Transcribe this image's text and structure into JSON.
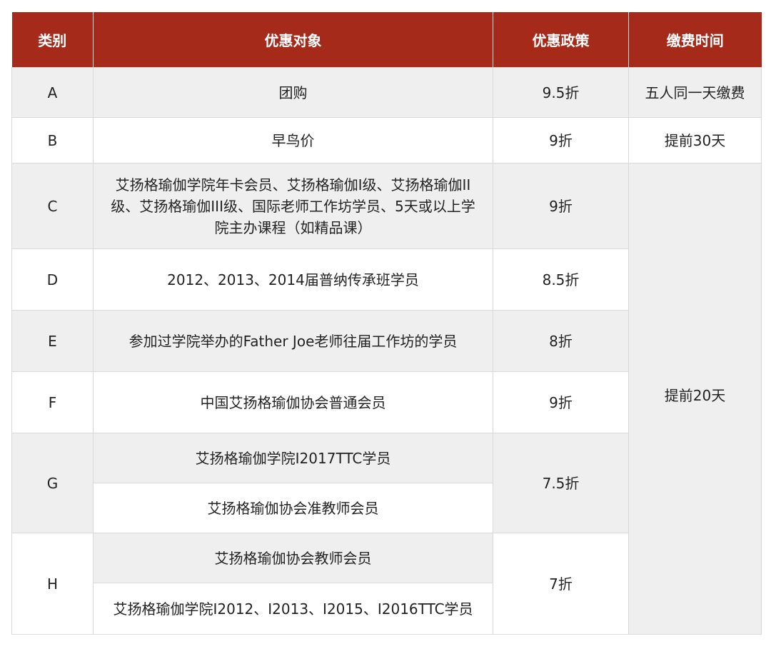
{
  "header": {
    "category": "类别",
    "target": "优惠对象",
    "policy": "优惠政策",
    "time": "缴费时间"
  },
  "rows": [
    {
      "category": "A",
      "target": "团购",
      "policy": "9.5折",
      "time": "五人同一天缴费"
    },
    {
      "category": "B",
      "target": "早鸟价",
      "policy": "9折",
      "time": "提前30天"
    },
    {
      "category": "C",
      "target": "艾扬格瑜伽学院年卡会员、艾扬格瑜伽I级、艾扬格瑜伽II级、艾扬格瑜伽III级、国际老师工作坊学员、5天或以上学院主办课程（如精品课）",
      "policy": "9折",
      "time": "提前20天"
    },
    {
      "category": "D",
      "target": "2012、2013、2014届普纳传承班学员",
      "policy": "8.5折"
    },
    {
      "category": "E",
      "target": "参加过学院举办的Father Joe老师往届工作坊的学员",
      "policy": "8折"
    },
    {
      "category": "F",
      "target": "中国艾扬格瑜伽协会普通会员",
      "policy": "9折"
    },
    {
      "category": "G",
      "targets": [
        "艾扬格瑜伽学院I2017TTC学员",
        "艾扬格瑜伽协会准教师会员"
      ],
      "policy": "7.5折"
    },
    {
      "category": "H",
      "targets": [
        "艾扬格瑜伽协会教师会员",
        "艾扬格瑜伽学院I2012、I2013、I2015、I2016TTC学员"
      ],
      "policy": "7折"
    }
  ],
  "colors": {
    "header_bg": "#a52a1a",
    "header_text": "#ffffff",
    "shade_bg": "#efefef",
    "border": "#d9d9d9"
  }
}
